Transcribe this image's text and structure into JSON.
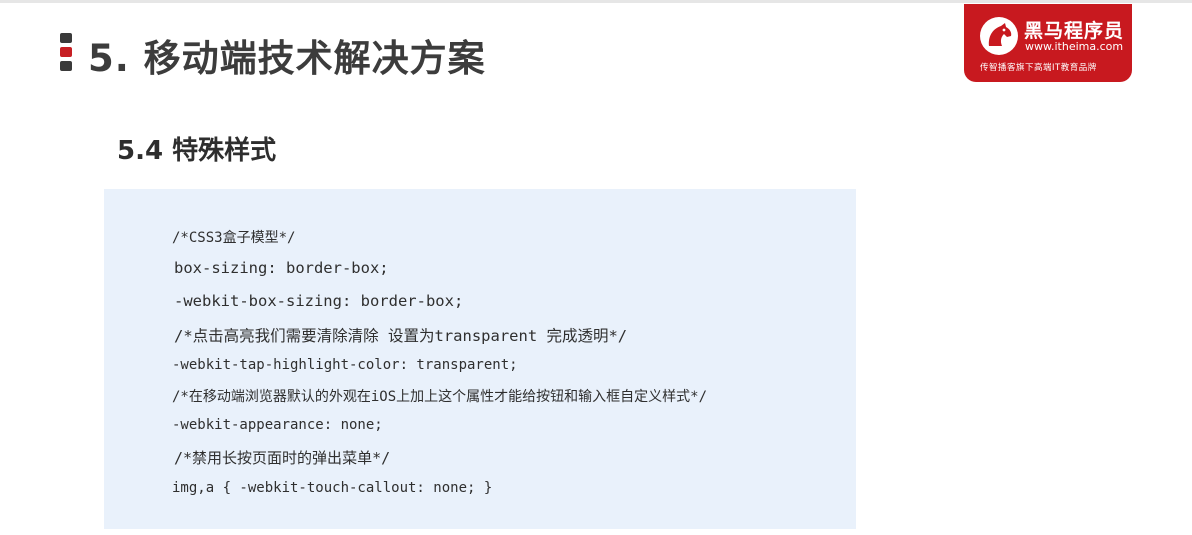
{
  "slide": {
    "title": "5. 移动端技术解决方案",
    "subtitle": "5.4 特殊样式"
  },
  "logo": {
    "name": "黑马程序员",
    "url": "www.itheima.com",
    "slogan": "传智播客旗下高端IT教育品牌"
  },
  "code": {
    "lines": [
      "/*CSS3盒子模型*/",
      "box-sizing: border-box;",
      "-webkit-box-sizing: border-box;",
      "/*点击高亮我们需要清除清除   设置为transparent 完成透明*/",
      "-webkit-tap-highlight-color: transparent;",
      "/*在移动端浏览器默认的外观在iOS上加上这个属性才能给按钮和输入框自定义样式*/",
      "-webkit-appearance: none;",
      "/*禁用长按页面时的弹出菜单*/",
      "img,a { -webkit-touch-callout: none; }"
    ]
  },
  "colors": {
    "brand_red": "#c8191f",
    "code_bg": "#e9f1fb",
    "title_text": "#3c3c3c"
  },
  "icons": {
    "title_marker": "stacked-square-bullets-icon",
    "logo_mark": "horse-head-logo-icon"
  }
}
